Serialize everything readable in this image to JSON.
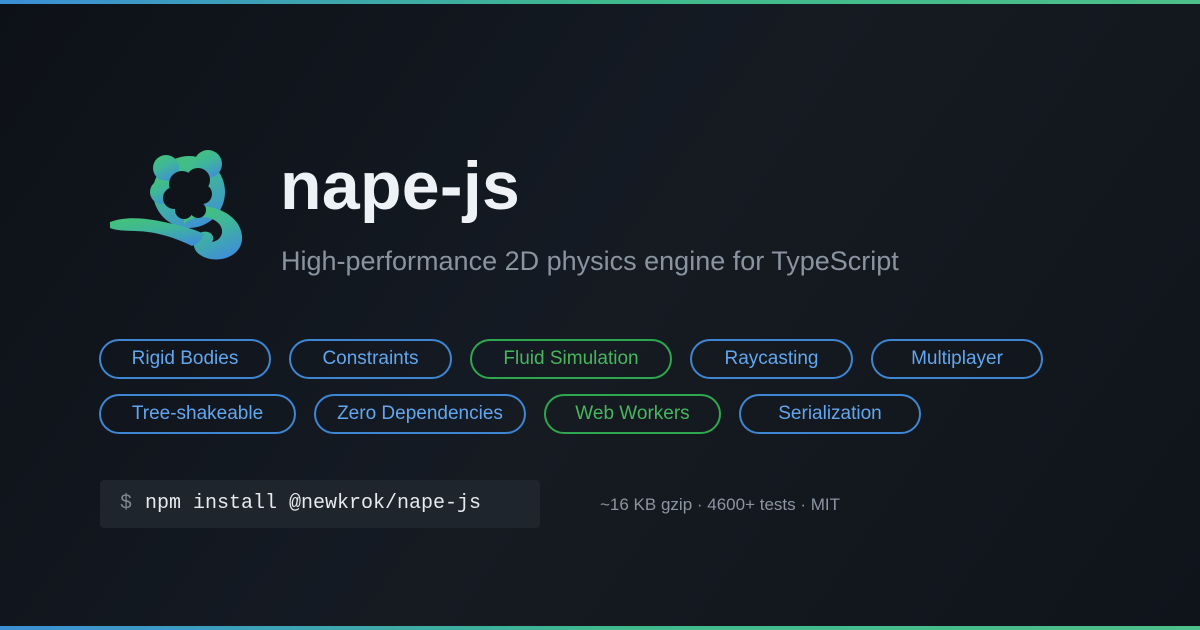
{
  "brand": {
    "name": "nape-js",
    "tagline": "High-performance 2D physics engine for TypeScript",
    "logo_icon": "monkey-head-logo-icon",
    "colors": {
      "background": "#0d1117",
      "accent_blue": "#3f86d2",
      "accent_green": "#2fa74e",
      "title": "#eef1f5"
    }
  },
  "features": {
    "row1": [
      {
        "label": "Rigid Bodies",
        "color": "blue"
      },
      {
        "label": "Constraints",
        "color": "blue"
      },
      {
        "label": "Fluid Simulation",
        "color": "green"
      },
      {
        "label": "Raycasting",
        "color": "blue"
      },
      {
        "label": "Multiplayer",
        "color": "blue"
      }
    ],
    "row2": [
      {
        "label": "Tree-shakeable",
        "color": "blue"
      },
      {
        "label": "Zero Dependencies",
        "color": "blue"
      },
      {
        "label": "Web Workers",
        "color": "green"
      },
      {
        "label": "Serialization",
        "color": "blue"
      }
    ]
  },
  "install": {
    "prompt": "$",
    "command": "npm install @newkrok/nape-js"
  },
  "stats": {
    "text": "~16 KB gzip · 4600+ tests · MIT"
  }
}
